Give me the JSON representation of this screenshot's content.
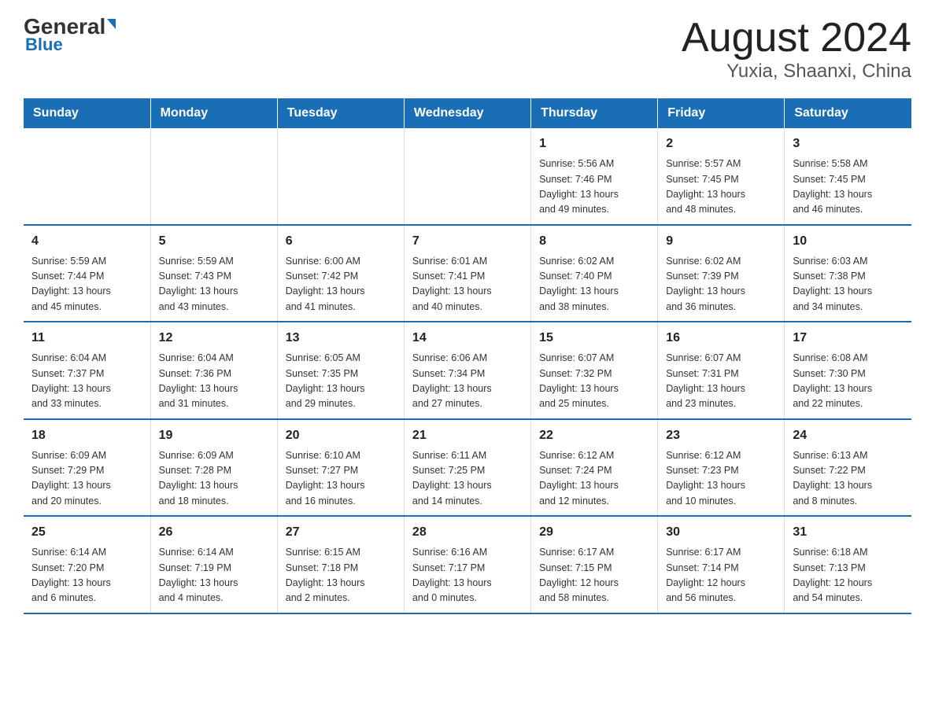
{
  "header": {
    "logo_general": "General",
    "logo_blue": "Blue",
    "month": "August 2024",
    "location": "Yuxia, Shaanxi, China"
  },
  "days_of_week": [
    "Sunday",
    "Monday",
    "Tuesday",
    "Wednesday",
    "Thursday",
    "Friday",
    "Saturday"
  ],
  "weeks": [
    [
      {
        "day": "",
        "info": ""
      },
      {
        "day": "",
        "info": ""
      },
      {
        "day": "",
        "info": ""
      },
      {
        "day": "",
        "info": ""
      },
      {
        "day": "1",
        "info": "Sunrise: 5:56 AM\nSunset: 7:46 PM\nDaylight: 13 hours\nand 49 minutes."
      },
      {
        "day": "2",
        "info": "Sunrise: 5:57 AM\nSunset: 7:45 PM\nDaylight: 13 hours\nand 48 minutes."
      },
      {
        "day": "3",
        "info": "Sunrise: 5:58 AM\nSunset: 7:45 PM\nDaylight: 13 hours\nand 46 minutes."
      }
    ],
    [
      {
        "day": "4",
        "info": "Sunrise: 5:59 AM\nSunset: 7:44 PM\nDaylight: 13 hours\nand 45 minutes."
      },
      {
        "day": "5",
        "info": "Sunrise: 5:59 AM\nSunset: 7:43 PM\nDaylight: 13 hours\nand 43 minutes."
      },
      {
        "day": "6",
        "info": "Sunrise: 6:00 AM\nSunset: 7:42 PM\nDaylight: 13 hours\nand 41 minutes."
      },
      {
        "day": "7",
        "info": "Sunrise: 6:01 AM\nSunset: 7:41 PM\nDaylight: 13 hours\nand 40 minutes."
      },
      {
        "day": "8",
        "info": "Sunrise: 6:02 AM\nSunset: 7:40 PM\nDaylight: 13 hours\nand 38 minutes."
      },
      {
        "day": "9",
        "info": "Sunrise: 6:02 AM\nSunset: 7:39 PM\nDaylight: 13 hours\nand 36 minutes."
      },
      {
        "day": "10",
        "info": "Sunrise: 6:03 AM\nSunset: 7:38 PM\nDaylight: 13 hours\nand 34 minutes."
      }
    ],
    [
      {
        "day": "11",
        "info": "Sunrise: 6:04 AM\nSunset: 7:37 PM\nDaylight: 13 hours\nand 33 minutes."
      },
      {
        "day": "12",
        "info": "Sunrise: 6:04 AM\nSunset: 7:36 PM\nDaylight: 13 hours\nand 31 minutes."
      },
      {
        "day": "13",
        "info": "Sunrise: 6:05 AM\nSunset: 7:35 PM\nDaylight: 13 hours\nand 29 minutes."
      },
      {
        "day": "14",
        "info": "Sunrise: 6:06 AM\nSunset: 7:34 PM\nDaylight: 13 hours\nand 27 minutes."
      },
      {
        "day": "15",
        "info": "Sunrise: 6:07 AM\nSunset: 7:32 PM\nDaylight: 13 hours\nand 25 minutes."
      },
      {
        "day": "16",
        "info": "Sunrise: 6:07 AM\nSunset: 7:31 PM\nDaylight: 13 hours\nand 23 minutes."
      },
      {
        "day": "17",
        "info": "Sunrise: 6:08 AM\nSunset: 7:30 PM\nDaylight: 13 hours\nand 22 minutes."
      }
    ],
    [
      {
        "day": "18",
        "info": "Sunrise: 6:09 AM\nSunset: 7:29 PM\nDaylight: 13 hours\nand 20 minutes."
      },
      {
        "day": "19",
        "info": "Sunrise: 6:09 AM\nSunset: 7:28 PM\nDaylight: 13 hours\nand 18 minutes."
      },
      {
        "day": "20",
        "info": "Sunrise: 6:10 AM\nSunset: 7:27 PM\nDaylight: 13 hours\nand 16 minutes."
      },
      {
        "day": "21",
        "info": "Sunrise: 6:11 AM\nSunset: 7:25 PM\nDaylight: 13 hours\nand 14 minutes."
      },
      {
        "day": "22",
        "info": "Sunrise: 6:12 AM\nSunset: 7:24 PM\nDaylight: 13 hours\nand 12 minutes."
      },
      {
        "day": "23",
        "info": "Sunrise: 6:12 AM\nSunset: 7:23 PM\nDaylight: 13 hours\nand 10 minutes."
      },
      {
        "day": "24",
        "info": "Sunrise: 6:13 AM\nSunset: 7:22 PM\nDaylight: 13 hours\nand 8 minutes."
      }
    ],
    [
      {
        "day": "25",
        "info": "Sunrise: 6:14 AM\nSunset: 7:20 PM\nDaylight: 13 hours\nand 6 minutes."
      },
      {
        "day": "26",
        "info": "Sunrise: 6:14 AM\nSunset: 7:19 PM\nDaylight: 13 hours\nand 4 minutes."
      },
      {
        "day": "27",
        "info": "Sunrise: 6:15 AM\nSunset: 7:18 PM\nDaylight: 13 hours\nand 2 minutes."
      },
      {
        "day": "28",
        "info": "Sunrise: 6:16 AM\nSunset: 7:17 PM\nDaylight: 13 hours\nand 0 minutes."
      },
      {
        "day": "29",
        "info": "Sunrise: 6:17 AM\nSunset: 7:15 PM\nDaylight: 12 hours\nand 58 minutes."
      },
      {
        "day": "30",
        "info": "Sunrise: 6:17 AM\nSunset: 7:14 PM\nDaylight: 12 hours\nand 56 minutes."
      },
      {
        "day": "31",
        "info": "Sunrise: 6:18 AM\nSunset: 7:13 PM\nDaylight: 12 hours\nand 54 minutes."
      }
    ]
  ]
}
